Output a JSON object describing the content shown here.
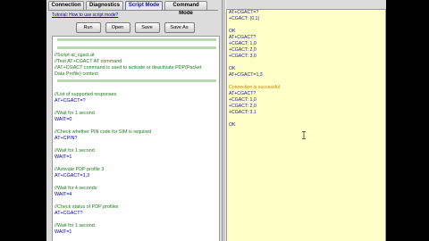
{
  "tabs": [
    {
      "label": "Connection"
    },
    {
      "label": "Diagnostics"
    },
    {
      "label": "Script Mode"
    },
    {
      "label": "Command Mode"
    }
  ],
  "tutorial_link": "Tutorial: How to use script mode?",
  "toolbar": {
    "run": "Run",
    "open": "Open",
    "save": "Save",
    "save_as": "Save As"
  },
  "script_lines": [
    {
      "kind": "sep",
      "text": ""
    },
    {
      "kind": "sep",
      "text": ""
    },
    {
      "kind": "comment",
      "text": "//Script at_cgact.at"
    },
    {
      "kind": "comment",
      "text": "//Test AT+CGACT AT command"
    },
    {
      "kind": "comment",
      "text": "//AT+CGACT command is used to activate or deactivate PDP(Packet"
    },
    {
      "kind": "comment",
      "text": "Data Profile) context"
    },
    {
      "kind": "sep",
      "text": ""
    },
    {
      "kind": "blank",
      "text": ""
    },
    {
      "kind": "comment",
      "text": "//List of supported responses"
    },
    {
      "kind": "cmd",
      "text": "AT+CGACT=?"
    },
    {
      "kind": "blank",
      "text": ""
    },
    {
      "kind": "comment",
      "text": "//Wait for 1 second"
    },
    {
      "kind": "cmd",
      "text": "WAIT=0"
    },
    {
      "kind": "blank",
      "text": ""
    },
    {
      "kind": "comment",
      "text": "//Check whether PIN code for SIM is required"
    },
    {
      "kind": "cmd",
      "text": "AT+CPIN?"
    },
    {
      "kind": "blank",
      "text": ""
    },
    {
      "kind": "comment",
      "text": "//Wait for 1 second"
    },
    {
      "kind": "cmd",
      "text": "WAIT=1"
    },
    {
      "kind": "blank",
      "text": ""
    },
    {
      "kind": "comment",
      "text": "//Activate PDP profile 3"
    },
    {
      "kind": "cmd",
      "text": "AT+CGACT=1,3"
    },
    {
      "kind": "blank",
      "text": ""
    },
    {
      "kind": "comment",
      "text": "//Wait for 4 seconds"
    },
    {
      "kind": "cmd",
      "text": "WAIT=4"
    },
    {
      "kind": "blank",
      "text": ""
    },
    {
      "kind": "comment",
      "text": "//Check status of PDP profiles"
    },
    {
      "kind": "cmd",
      "text": "AT+CGACT?"
    },
    {
      "kind": "blank",
      "text": ""
    },
    {
      "kind": "comment",
      "text": "//Wait for 1 second"
    },
    {
      "kind": "cmd",
      "text": "WAIT=1"
    }
  ],
  "console_lines": [
    {
      "kind": "ok",
      "text": "AT+CGACT=?"
    },
    {
      "kind": "ok",
      "text": "+CGACT: (0,1)"
    },
    {
      "kind": "ok",
      "text": ""
    },
    {
      "kind": "ok",
      "text": "OK"
    },
    {
      "kind": "ok",
      "text": "AT+CGACT?"
    },
    {
      "kind": "ok",
      "text": "+CGACT: 1,0"
    },
    {
      "kind": "ok",
      "text": "+CGACT: 2,0"
    },
    {
      "kind": "ok",
      "text": "+CGACT: 3,0"
    },
    {
      "kind": "ok",
      "text": ""
    },
    {
      "kind": "ok",
      "text": "OK"
    },
    {
      "kind": "ok",
      "text": "AT+CGACT=1,3"
    },
    {
      "kind": "ok",
      "text": ""
    },
    {
      "kind": "note",
      "text": "Connection is successful"
    },
    {
      "kind": "ok",
      "text": "AT+CGACT?"
    },
    {
      "kind": "ok",
      "text": "+CGACT: 1,0"
    },
    {
      "kind": "ok",
      "text": "+CGACT: 2,0"
    },
    {
      "kind": "ok",
      "text": "+CGACT: 3,1"
    },
    {
      "kind": "ok",
      "text": ""
    },
    {
      "kind": "ok",
      "text": "OK"
    }
  ],
  "colors": {
    "console_bg": "#ffffc8",
    "comment": "#1d7a1d",
    "command": "#0000b4",
    "link": "#0000c8"
  }
}
